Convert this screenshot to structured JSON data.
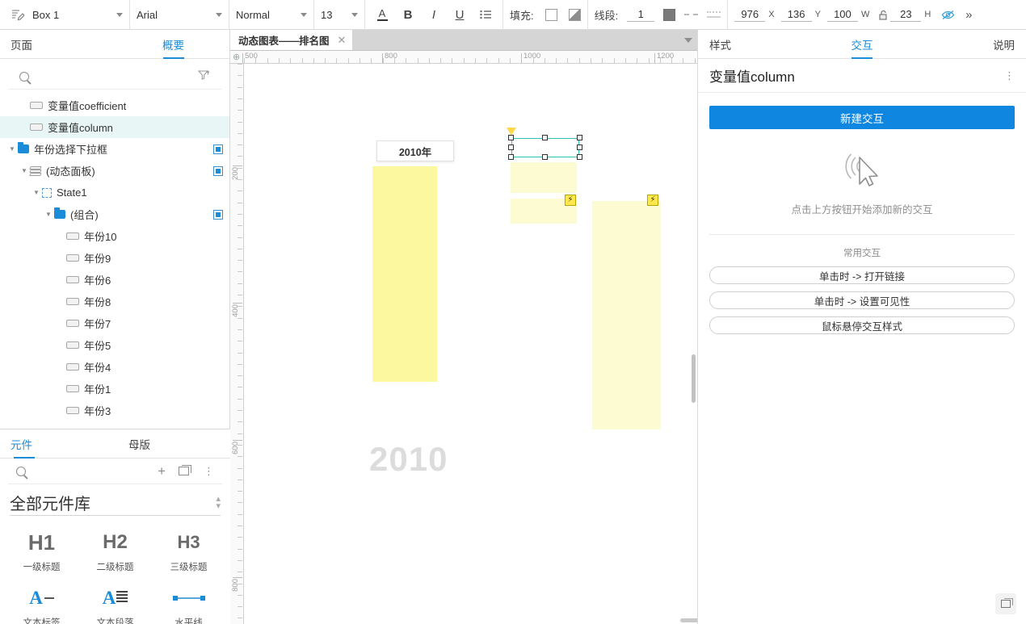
{
  "toolbar": {
    "style_icon": "text-style-icon",
    "style_name": "Box 1",
    "font_family": "Arial",
    "font_weight": "Normal",
    "font_size": "13",
    "color_icon": "font-color-icon",
    "bold_icon": "bold-icon",
    "italic_icon": "italic-icon",
    "underline_icon": "underline-icon",
    "list_icon": "bullet-list-icon",
    "fill_label": "填充:",
    "line_label": "线段:",
    "line_width": "1",
    "x_value": "976",
    "x_label": "X",
    "y_value": "136",
    "y_label": "Y",
    "w_value": "100",
    "w_label": "W",
    "h_value": "23",
    "h_label": "H",
    "lock_icon": "unlock-icon",
    "hide_icon": "eye-off-icon",
    "more_icon": "chevron-double-right-icon"
  },
  "left_panel": {
    "tabs": [
      {
        "label": "页面",
        "active": false
      },
      {
        "label": "概要",
        "active": true
      }
    ],
    "search_placeholder": "",
    "search_icon": "search-icon",
    "filter_icon": "filter-icon",
    "tree": [
      {
        "label": "变量值coefficient",
        "icon": "widget-icon",
        "indent": 1,
        "selected": false,
        "arrow": "",
        "eye": false
      },
      {
        "label": "变量值column",
        "icon": "widget-icon",
        "indent": 1,
        "selected": true,
        "arrow": "",
        "eye": false
      },
      {
        "label": "年份选择下拉框",
        "icon": "folder-icon",
        "indent": 0,
        "selected": false,
        "arrow": "▼",
        "eye": true
      },
      {
        "label": "(动态面板)",
        "icon": "dynamic-panel-icon",
        "indent": 1,
        "selected": false,
        "arrow": "▼",
        "eye": true
      },
      {
        "label": "State1",
        "icon": "state-icon",
        "indent": 2,
        "selected": false,
        "arrow": "▼",
        "eye": false
      },
      {
        "label": "(组合)",
        "icon": "folder-icon",
        "indent": 3,
        "selected": false,
        "arrow": "▼",
        "eye": true
      },
      {
        "label": "年份10",
        "icon": "widget-icon",
        "indent": 4,
        "selected": false,
        "arrow": "",
        "eye": false
      },
      {
        "label": "年份9",
        "icon": "widget-icon",
        "indent": 4,
        "selected": false,
        "arrow": "",
        "eye": false
      },
      {
        "label": "年份6",
        "icon": "widget-icon",
        "indent": 4,
        "selected": false,
        "arrow": "",
        "eye": false
      },
      {
        "label": "年份8",
        "icon": "widget-icon",
        "indent": 4,
        "selected": false,
        "arrow": "",
        "eye": false
      },
      {
        "label": "年份7",
        "icon": "widget-icon",
        "indent": 4,
        "selected": false,
        "arrow": "",
        "eye": false
      },
      {
        "label": "年份5",
        "icon": "widget-icon",
        "indent": 4,
        "selected": false,
        "arrow": "",
        "eye": false
      },
      {
        "label": "年份4",
        "icon": "widget-icon",
        "indent": 4,
        "selected": false,
        "arrow": "",
        "eye": false
      },
      {
        "label": "年份1",
        "icon": "widget-icon",
        "indent": 4,
        "selected": false,
        "arrow": "",
        "eye": false
      },
      {
        "label": "年份3",
        "icon": "widget-icon",
        "indent": 4,
        "selected": false,
        "arrow": "",
        "eye": false
      }
    ]
  },
  "library_panel": {
    "tabs": [
      {
        "label": "元件",
        "active": true
      },
      {
        "label": "母版",
        "active": false
      }
    ],
    "search_icon": "search-icon",
    "add_icon": "plus-icon",
    "duplicate_icon": "copy-icon",
    "more_icon": "more-vertical-icon",
    "selected_library": "全部元件库",
    "items": [
      {
        "glyph": "H1",
        "caption": "一级标题",
        "kind": "heading"
      },
      {
        "glyph": "H2",
        "caption": "二级标题",
        "kind": "heading"
      },
      {
        "glyph": "H3",
        "caption": "三级标题",
        "kind": "heading"
      },
      {
        "glyph": "A",
        "caption": "文本标签",
        "kind": "label"
      },
      {
        "glyph": "A",
        "caption": "文本段落",
        "kind": "paragraph"
      },
      {
        "glyph": "—",
        "caption": "水平线",
        "kind": "hline"
      }
    ]
  },
  "canvas": {
    "page_tab": "动态图表——排名图",
    "close_icon": "close-icon",
    "tabs_dropdown_icon": "chevron-down-icon",
    "origin_icon": "origin-crosshair-icon",
    "ruler_h_labels": [
      "500",
      "800",
      "1000",
      "1200"
    ],
    "ruler_v_labels": [
      "200",
      "400",
      "600",
      "800"
    ],
    "dropdown_label": "2010年",
    "year_big": "2010",
    "bolt_icon": "interaction-bolt-icon",
    "selection_flag_icon": "selection-marker-icon",
    "colors": {
      "bar_strong": "#fcf8a0",
      "bar_light": "#fdfbd2",
      "selection": "#2fc2bb",
      "bolt": "#ffe84d",
      "year_text": "#dcdcdc"
    }
  },
  "right_panel": {
    "tabs": [
      {
        "label": "样式",
        "active": false
      },
      {
        "label": "交互",
        "active": true
      },
      {
        "label": "说明",
        "active": false
      }
    ],
    "title": "变量值column",
    "more_icon": "more-vertical-icon",
    "new_interaction_button": "新建交互",
    "empty_icon": "click-cursor-icon",
    "empty_text": "点击上方按钮开始添加新的交互",
    "common_title": "常用交互",
    "common_items": [
      "单击时 -> 打开链接",
      "单击时 -> 设置可见性",
      "鼠标悬停交互样式"
    ],
    "bottom_right_icon": "duplicate-icon",
    "accent_color": "#0f87e0"
  }
}
